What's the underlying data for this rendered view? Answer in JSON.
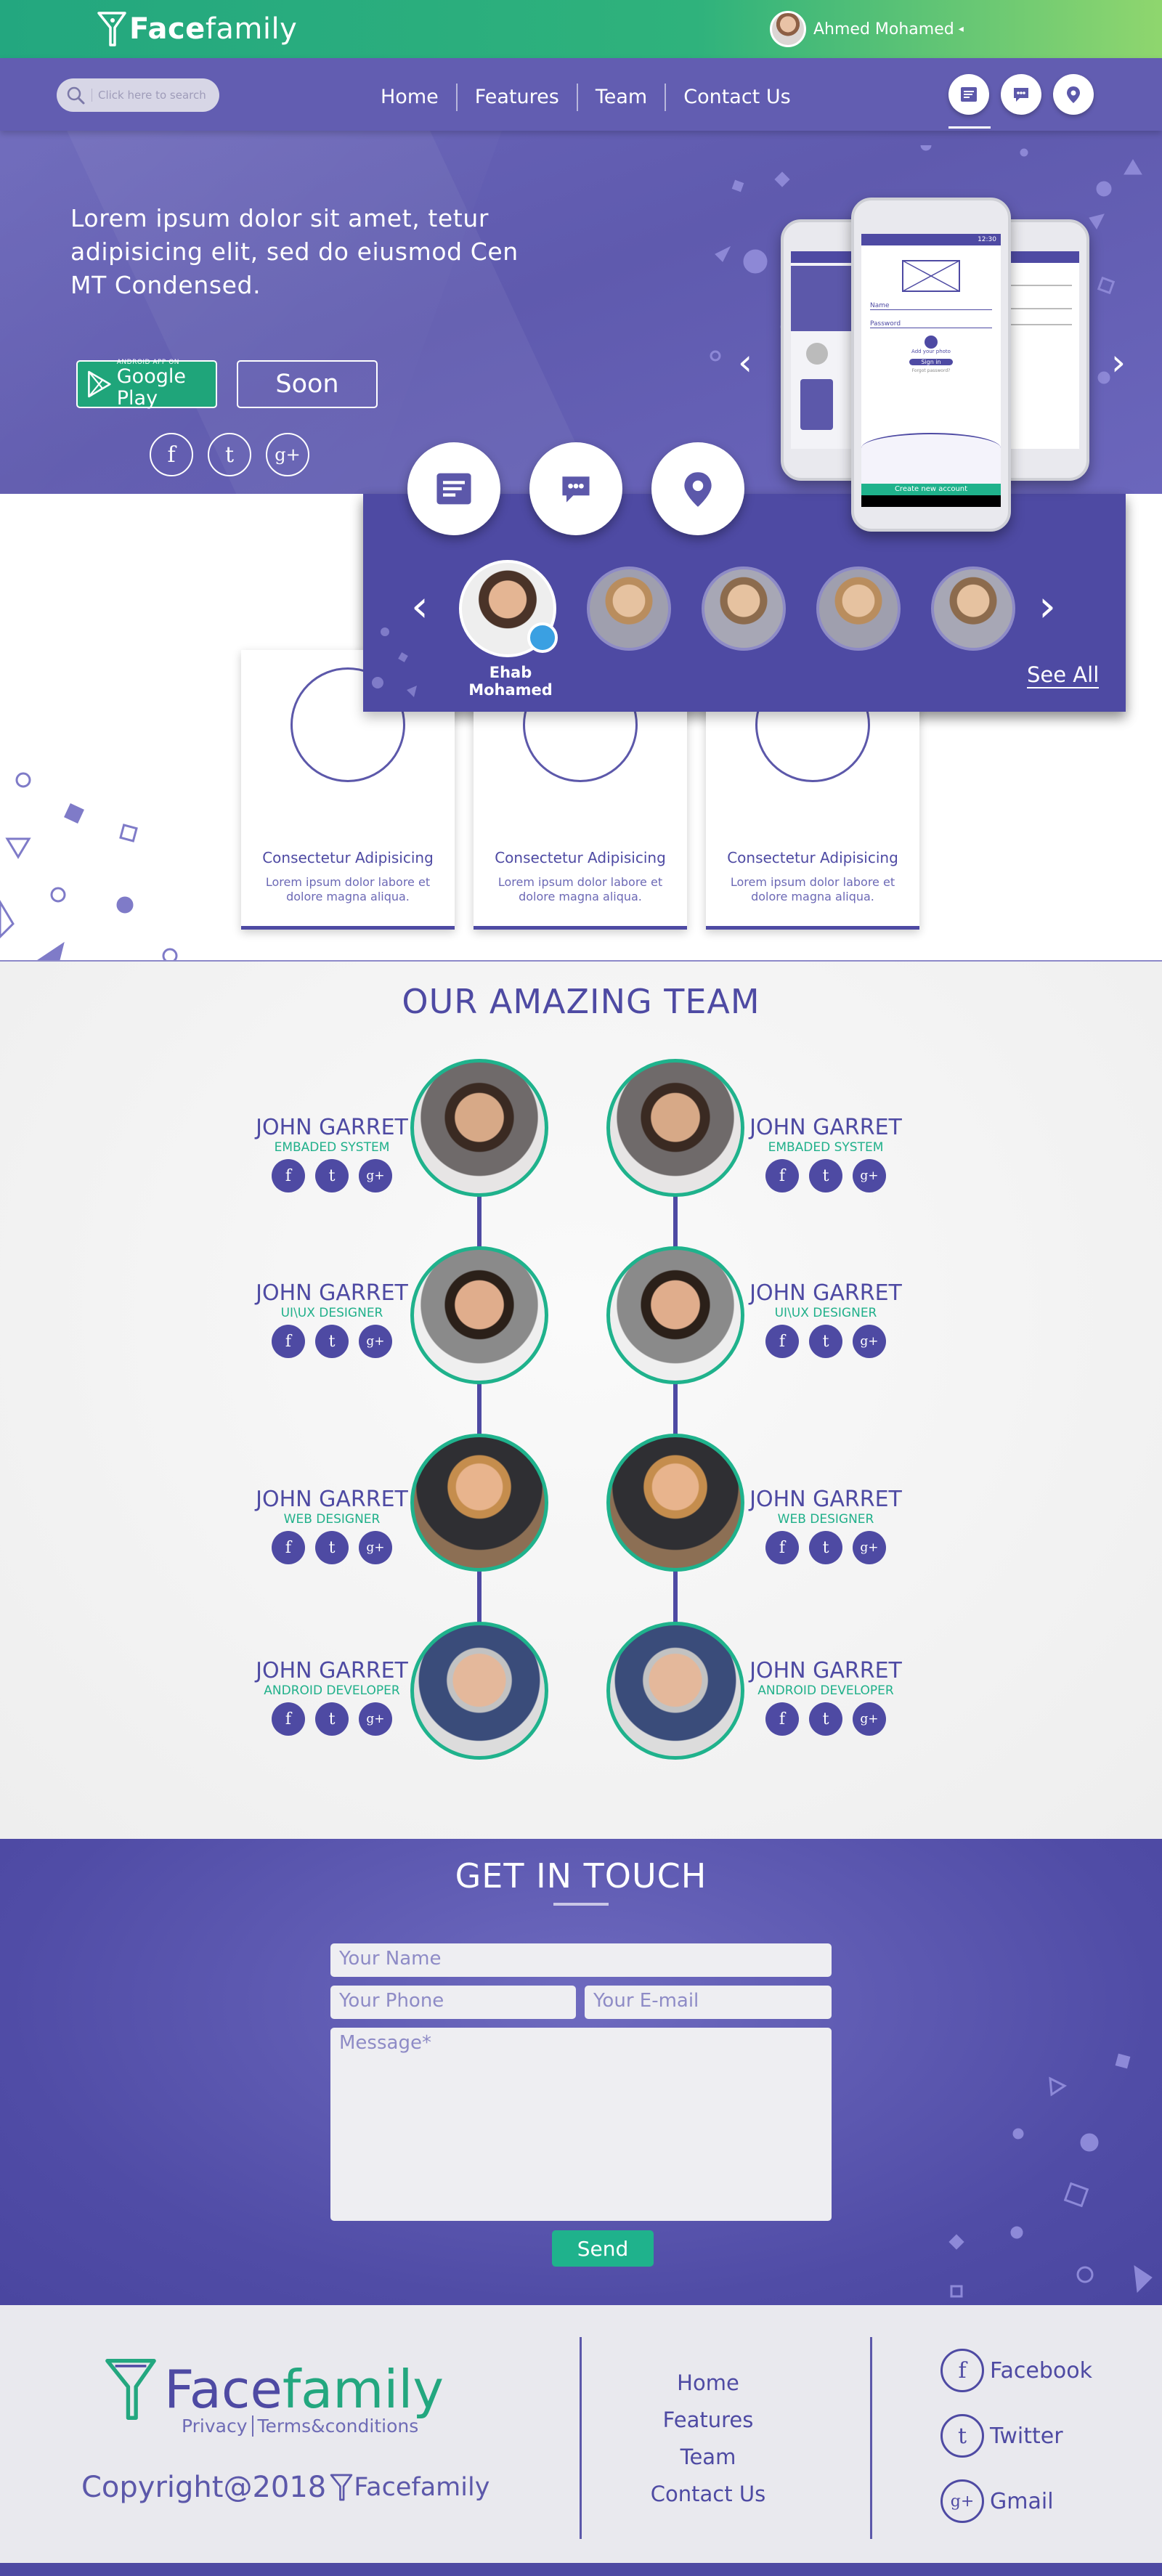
{
  "brand": {
    "name_bold": "Face",
    "name_light": "family",
    "logo_icon": "funnel-logo-icon"
  },
  "user": {
    "name": "Ahmed Mohamed",
    "caret": "◂"
  },
  "search": {
    "placeholder": "Click here to search",
    "icon": "search-icon"
  },
  "nav": {
    "items": [
      "Home",
      "Features",
      "Team",
      "Contact Us"
    ],
    "icons": [
      "newsfeed-icon",
      "chat-icon",
      "location-pin-icon"
    ],
    "active_icon": "newsfeed-icon"
  },
  "hero": {
    "headline": "Lorem ipsum dolor sit amet, tetur adipisicing elit, sed do eiusmod Cen MT Condensed.",
    "play_small": "ANDROID APP ON",
    "play_big": "Google Play",
    "soon_label": "Soon",
    "social": [
      "f",
      "t",
      "g+"
    ],
    "phone": {
      "status_time": "12:30",
      "name_label": "Name",
      "password_label": "Password",
      "add_photo": "Add your photo",
      "sign_in": "Sign in",
      "forgot": "Forgot password?",
      "create_account": "Create new account"
    },
    "prev_arrow": "‹",
    "next_arrow": "›"
  },
  "carousel": {
    "icons": [
      "newsfeed-icon",
      "chat-icon",
      "location-pin-icon"
    ],
    "active_name": "Ehab Mohamed",
    "see_all": "See All",
    "prev_arrow": "‹",
    "next_arrow": "›"
  },
  "features": [
    {
      "title": "Consectetur Adipisicing",
      "desc": "Lorem ipsum dolor labore et dolore magna aliqua."
    },
    {
      "title": "Consectetur Adipisicing",
      "desc": "Lorem ipsum dolor labore et dolore magna aliqua."
    },
    {
      "title": "Consectetur Adipisicing",
      "desc": "Lorem ipsum dolor labore et dolore magna aliqua."
    }
  ],
  "team": {
    "title": "OUR AMAZING TEAM",
    "members": [
      {
        "name": "JOHN GARRET",
        "role": "EMBADED SYSTEM"
      },
      {
        "name": "JOHN GARRET",
        "role": "UI\\UX DESIGNER"
      },
      {
        "name": "JOHN GARRET",
        "role": "WEB DESIGNER"
      },
      {
        "name": "JOHN GARRET",
        "role": "ANDROID DEVELOPER"
      }
    ],
    "social": [
      "f",
      "t",
      "g+"
    ]
  },
  "contact": {
    "title": "GET IN TOUCH",
    "name_placeholder": "Your Name",
    "phone_placeholder": "Your Phone",
    "email_placeholder": "Your E-mail",
    "message_placeholder": "Message*",
    "send_label": "Send"
  },
  "footer": {
    "privacy": "Privacy",
    "terms": "Terms&conditions",
    "copyright": "Copyright@2018",
    "nav": [
      "Home",
      "Features",
      "Team",
      "Contact Us"
    ],
    "social": [
      {
        "glyph": "f",
        "label": "Facebook"
      },
      {
        "glyph": "t",
        "label": "Twitter"
      },
      {
        "glyph": "g+",
        "label": "Gmail"
      }
    ]
  },
  "colors": {
    "primary": "#4e4aa3",
    "accent": "#1fb28c",
    "topbar": "#23a77f",
    "hero": "#625db1"
  }
}
